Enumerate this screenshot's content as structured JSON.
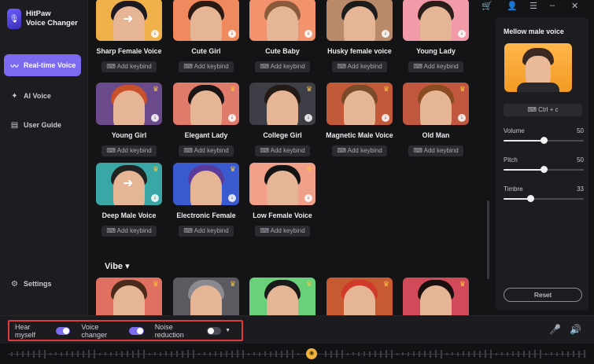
{
  "app": {
    "name_line1": "HitPaw",
    "name_line2": "Voice Changer"
  },
  "sidebar": {
    "items": [
      {
        "label": "Real-time Voice",
        "icon": "waveform-icon",
        "active": true
      },
      {
        "label": "AI Voice",
        "icon": "ai-icon",
        "active": false
      },
      {
        "label": "User Guide",
        "icon": "book-icon",
        "active": false
      }
    ],
    "settings_label": "Settings"
  },
  "voices": [
    {
      "label": "Sharp Female Voice",
      "keybind": "Add keybind",
      "bg": "#f0b04a",
      "hair": "#1e1a22",
      "crown": false,
      "swap": true
    },
    {
      "label": "Cute Girl",
      "keybind": "Add keybind",
      "bg": "#f08a5e",
      "hair": "#2a1a12",
      "crown": false,
      "swap": false
    },
    {
      "label": "Cute Baby",
      "keybind": "Add keybind",
      "bg": "#f2936d",
      "hair": "#8a5a3a",
      "crown": false,
      "swap": false
    },
    {
      "label": "Husky female voice",
      "keybind": "Add keybind",
      "bg": "#b98a6a",
      "hair": "#1c1c1c",
      "crown": false,
      "swap": false
    },
    {
      "label": "Young Lady",
      "keybind": "Add keybind",
      "bg": "#f29aa8",
      "hair": "#2a1e1a",
      "crown": false,
      "swap": false
    },
    {
      "label": "Young Girl",
      "keybind": "Add keybind",
      "bg": "#6a4a8a",
      "hair": "#c8502a",
      "crown": true,
      "swap": false
    },
    {
      "label": "Elegant Lady",
      "keybind": "Add keybind",
      "bg": "#e07a6a",
      "hair": "#1a1414",
      "crown": true,
      "swap": false
    },
    {
      "label": "College Girl",
      "keybind": "Add keybind",
      "bg": "#3e3e46",
      "hair": "#241a16",
      "crown": true,
      "swap": false
    },
    {
      "label": "Magnetic Male Voice",
      "keybind": "Add keybind",
      "bg": "#c25a3a",
      "hair": "#7a4a2a",
      "crown": true,
      "swap": false
    },
    {
      "label": "Old Man",
      "keybind": "Add keybind",
      "bg": "#c0573e",
      "hair": "#8a4a22",
      "crown": true,
      "swap": false
    },
    {
      "label": "Deep Male Voice",
      "keybind": "Add keybind",
      "bg": "#3aa6a6",
      "hair": "#222222",
      "crown": true,
      "swap": true
    },
    {
      "label": "Electronic Female",
      "keybind": "Add keybind",
      "bg": "#3a5ad0",
      "hair": "#5a3a9a",
      "crown": true,
      "swap": false
    },
    {
      "label": "Low Female Voice",
      "keybind": "Add keybind",
      "bg": "#f0a088",
      "hair": "#141414",
      "crown": true,
      "swap": false
    }
  ],
  "vibe": {
    "title": "Vibe ▾",
    "cards": [
      {
        "bg": "#e07060",
        "hair": "#4a2a1a"
      },
      {
        "bg": "#5a5a60",
        "hair": "#8a8a90"
      },
      {
        "bg": "#6ad07a",
        "hair": "#1a1a1a"
      },
      {
        "bg": "#c85a32",
        "hair": "#d03a2a"
      },
      {
        "bg": "#d04a5a",
        "hair": "#1a1010"
      }
    ]
  },
  "panel": {
    "title": "Mellow male voice",
    "shortcut": "Ctrl + c",
    "sliders": [
      {
        "label": "Volume",
        "value": 50,
        "max": 100
      },
      {
        "label": "Pitch",
        "value": 50,
        "max": 100
      },
      {
        "label": "Timbre",
        "value": 33,
        "max": 100
      }
    ],
    "reset_label": "Reset"
  },
  "bottom": {
    "hear_myself": "Hear myself",
    "hear_myself_on": true,
    "voice_changer": "Voice changer",
    "voice_changer_on": true,
    "noise_reduction": "Noise reduction",
    "noise_reduction_on": false
  }
}
